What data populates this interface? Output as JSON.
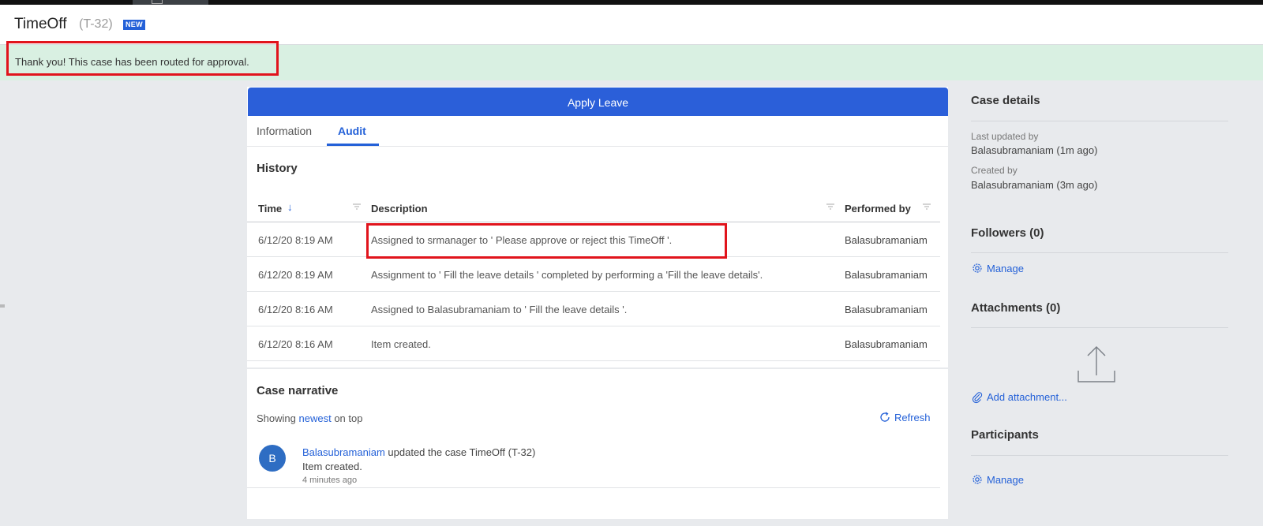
{
  "header": {
    "title": "TimeOff",
    "case_id": "(T-32)",
    "badge": "NEW"
  },
  "banner": {
    "message": "Thank you! This case has been routed for approval."
  },
  "main": {
    "action_bar_label": "Apply Leave",
    "tabs": [
      {
        "label": "Information"
      },
      {
        "label": "Audit",
        "active": true
      }
    ],
    "history": {
      "title": "History",
      "columns": [
        "Time",
        "Description",
        "Performed by"
      ],
      "rows": [
        {
          "time": "6/12/20 8:19 AM",
          "description": "Assigned to srmanager to ' Please approve or reject this TimeOff '.",
          "performed_by": "Balasubramaniam"
        },
        {
          "time": "6/12/20 8:19 AM",
          "description": "Assignment to ' Fill the leave details ' completed by performing a 'Fill the leave details'.",
          "performed_by": "Balasubramaniam"
        },
        {
          "time": "6/12/20 8:16 AM",
          "description": "Assigned to Balasubramaniam to ' Fill the leave details '.",
          "performed_by": "Balasubramaniam"
        },
        {
          "time": "6/12/20 8:16 AM",
          "description": "Item created.",
          "performed_by": "Balasubramaniam"
        }
      ]
    },
    "narrative": {
      "title": "Case narrative",
      "showing_prefix": "Showing",
      "showing_link": "newest",
      "showing_suffix": "on top",
      "refresh_label": "Refresh",
      "entry": {
        "avatar_initial": "B",
        "user": "Balasubramaniam",
        "action": "updated the case TimeOff (T-32)",
        "detail": "Item created.",
        "time": "4 minutes ago"
      }
    }
  },
  "sidebar": {
    "case_details": {
      "title": "Case details",
      "last_updated_label": "Last updated by",
      "last_updated_value": "Balasubramaniam (1m ago)",
      "created_label": "Created by",
      "created_value": "Balasubramaniam (3m ago)"
    },
    "followers": {
      "title": "Followers (0)",
      "manage_label": "Manage"
    },
    "attachments": {
      "title": "Attachments (0)",
      "add_label": "Add attachment..."
    },
    "participants": {
      "title": "Participants",
      "manage_label": "Manage"
    }
  },
  "colors": {
    "accent": "#2461d8",
    "action_bar": "#2b5fd9",
    "banner_bg": "#d9f0e2",
    "highlight_box": "#e1141c",
    "page_bg": "#e8eaed"
  },
  "icons": [
    "sort-down-icon",
    "filter-icon",
    "refresh-icon",
    "gear-icon",
    "paperclip-icon",
    "upload-icon"
  ]
}
